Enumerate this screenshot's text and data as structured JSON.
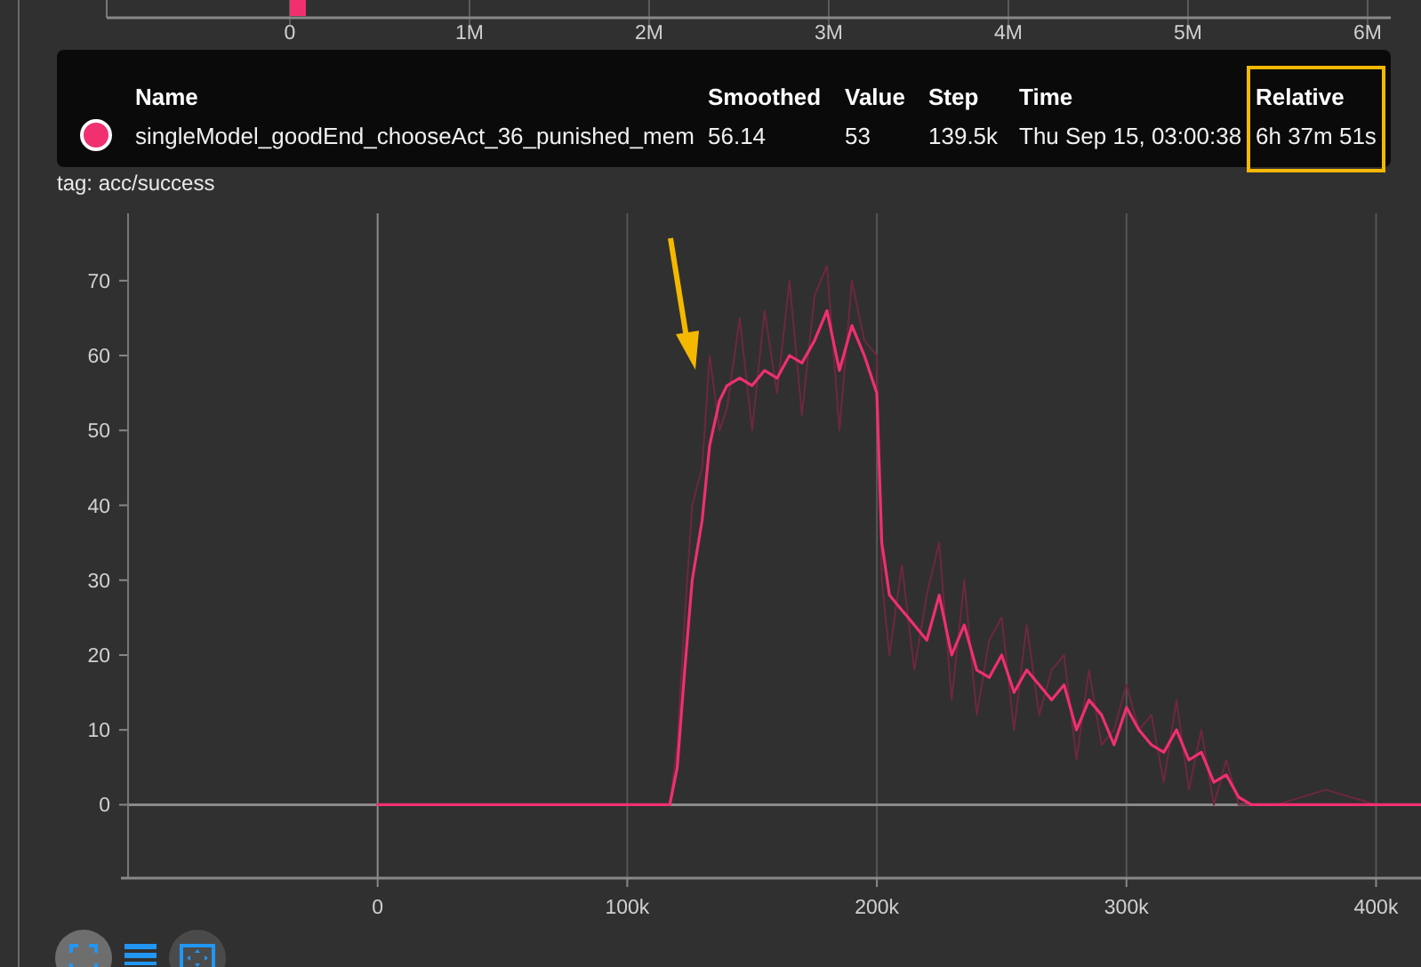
{
  "upper_chart": {
    "xtick_labels": [
      "0",
      "1M",
      "2M",
      "3M",
      "4M",
      "5M",
      "6M"
    ]
  },
  "card": {
    "tag": "tag: acc/success",
    "chart_data": {
      "type": "line",
      "grid": true,
      "xlim": [
        -100000,
        418000
      ],
      "ylim": [
        -9.8,
        79
      ],
      "xticks": [
        {
          "value": 0,
          "label": "0"
        },
        {
          "value": 100000,
          "label": "100k"
        },
        {
          "value": 200000,
          "label": "200k"
        },
        {
          "value": 300000,
          "label": "300k"
        },
        {
          "value": 400000,
          "label": "400k"
        }
      ],
      "yticks": [
        0,
        10,
        20,
        30,
        40,
        50,
        60,
        70
      ],
      "x": [
        0,
        50000,
        100000,
        117000,
        120000,
        123000,
        126000,
        130000,
        133000,
        137000,
        140000,
        145000,
        150000,
        155000,
        160000,
        165000,
        170000,
        175000,
        180000,
        185000,
        190000,
        195000,
        200000,
        202000,
        205000,
        210000,
        215000,
        220000,
        225000,
        230000,
        235000,
        240000,
        245000,
        250000,
        255000,
        260000,
        265000,
        270000,
        275000,
        280000,
        285000,
        290000,
        295000,
        300000,
        305000,
        310000,
        315000,
        320000,
        325000,
        330000,
        335000,
        340000,
        345000,
        350000,
        360000,
        380000,
        400000,
        418000
      ],
      "series": [
        {
          "color": "#6e2741",
          "values": [
            0,
            0,
            0,
            0,
            8,
            25,
            40,
            45,
            60,
            50,
            53,
            65,
            50,
            66,
            55,
            70,
            52,
            68,
            72,
            50,
            70,
            62,
            60,
            30,
            20,
            32,
            18,
            28,
            35,
            14,
            30,
            12,
            22,
            25,
            10,
            24,
            12,
            18,
            20,
            6,
            18,
            8,
            10,
            16,
            10,
            12,
            3,
            14,
            2,
            10,
            0,
            6,
            0,
            0,
            0,
            2,
            0,
            0
          ]
        },
        {
          "color": "#f0306f",
          "values": [
            0,
            0,
            0,
            0,
            5,
            18,
            30,
            38,
            48,
            54,
            56,
            57,
            56,
            58,
            57,
            60,
            59,
            62,
            66,
            58,
            64,
            60,
            55,
            35,
            28,
            26,
            24,
            22,
            28,
            20,
            24,
            18,
            17,
            20,
            15,
            18,
            16,
            14,
            16,
            10,
            14,
            12,
            8,
            13,
            10,
            8,
            7,
            10,
            6,
            7,
            3,
            4,
            1,
            0,
            0,
            0,
            0,
            0
          ]
        }
      ]
    }
  },
  "tooltip": {
    "columns": [
      "Name",
      "Smoothed",
      "Value",
      "Step",
      "Time",
      "Relative"
    ],
    "rows": [
      {
        "color": "#f0306f",
        "cells": [
          "singleModel_goodEnd_chooseAct_36_punished_mem",
          "56.14",
          "53",
          "139.5k",
          "Thu Sep 15, 03:00:38",
          "6h 37m 51s"
        ]
      }
    ]
  }
}
